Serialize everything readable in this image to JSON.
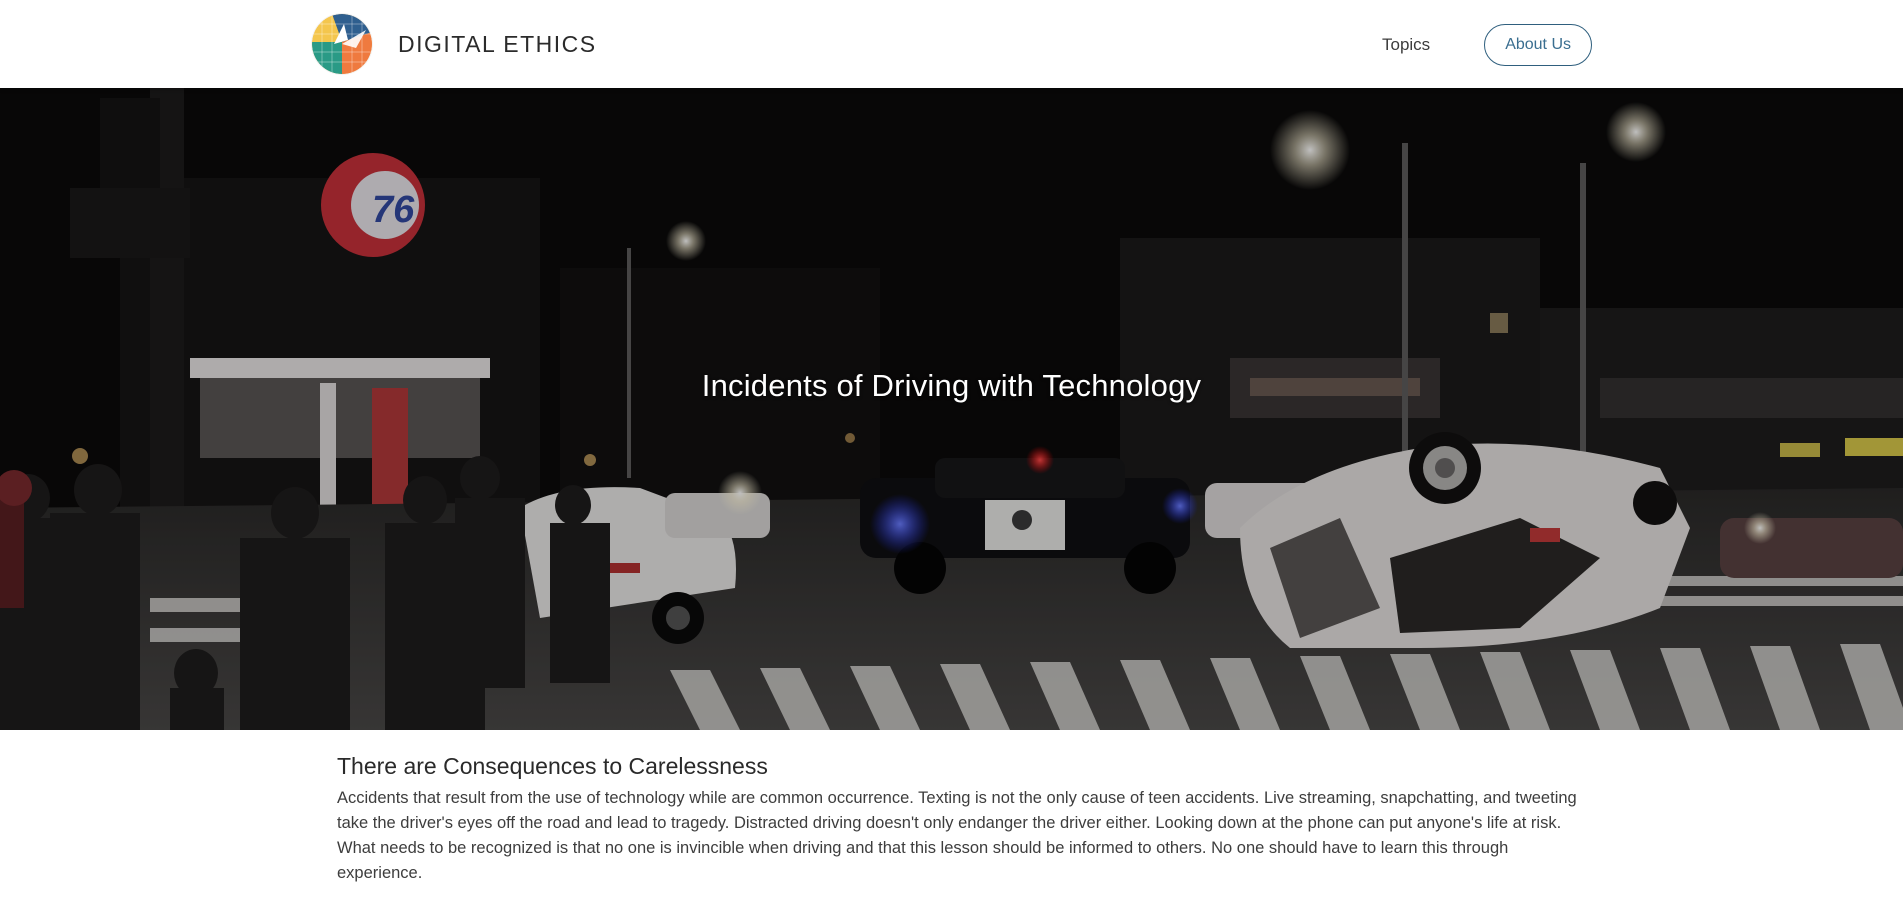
{
  "header": {
    "brand_name": "DIGITAL ETHICS",
    "logo_icon": "globe-logo-icon",
    "nav": {
      "topics_label": "Topics",
      "about_label": "About Us"
    },
    "accent_color": "#2f5f7e"
  },
  "hero": {
    "title": "Incidents of Driving with Technology",
    "image_description_icon": "car-crash-night-photo"
  },
  "article": {
    "heading": "There are Consequences to Carelessness",
    "body": "Accidents that result from the use of technology while are common occurrence. Texting is not the only cause of teen accidents. Live streaming, snapchatting, and tweeting take the driver's eyes off the road and lead to tragedy. Distracted driving doesn't only endanger the driver either. Looking down at the phone can put anyone's life at risk. What needs to be recognized is that no one is invincible when driving and that this lesson should be informed to others. No one should have to learn this through experience."
  }
}
